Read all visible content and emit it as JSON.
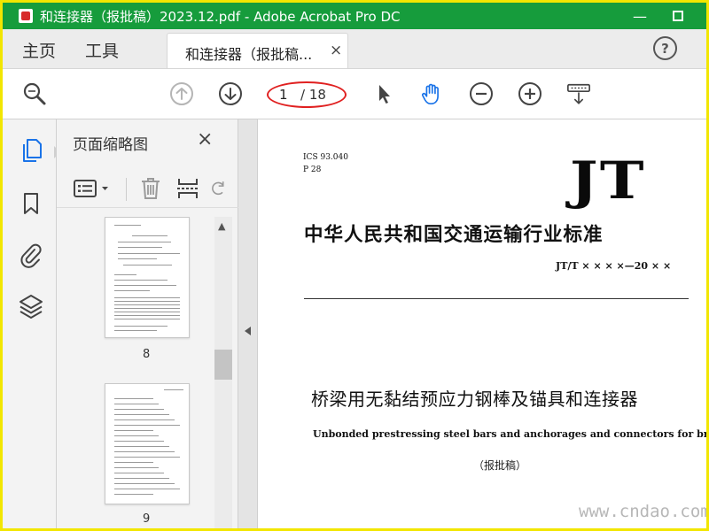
{
  "window": {
    "title": "和连接器（报批稿）2023.12.pdf - Adobe Acrobat Pro DC",
    "min_glyph": "—"
  },
  "menu": {
    "home": "主页",
    "tools": "工具",
    "doc_tab": "和连接器（报批稿...",
    "doc_tab_close": "×",
    "help": "?"
  },
  "toolbar": {
    "current_page": "1",
    "total_pages": "/ 18"
  },
  "thumbnails": {
    "panel_title": "页面缩略图",
    "close": "×",
    "pages": [
      "8",
      "9"
    ]
  },
  "document": {
    "ics": "ICS 93.040",
    "p": "P 28",
    "logo": "JT",
    "standard_title": "中华人民共和国交通运输行业标准",
    "standard_number": "JT/T  × × × ×—20 × ×",
    "cn_title": "桥梁用无黏结预应力钢棒及锚具和连接器",
    "en_title": "Unbonded prestressing steel bars and anchorages and connectors for bridges",
    "draft_note": "（报批稿）"
  },
  "watermark": "www.cndao.com",
  "colors": {
    "titlebar": "#169c3c",
    "frame": "#f2e600",
    "highlight_oval": "#e02020",
    "hand_tool": "#1a73e8"
  },
  "icons": {
    "toolbar": [
      "zoom-search-icon",
      "page-up-icon",
      "page-down-icon",
      "select-arrow-icon",
      "hand-icon",
      "zoom-out-icon",
      "zoom-in-icon",
      "scroll-mode-icon"
    ],
    "rail": [
      "pages-icon",
      "bookmark-icon",
      "attachment-icon",
      "layers-icon"
    ]
  }
}
